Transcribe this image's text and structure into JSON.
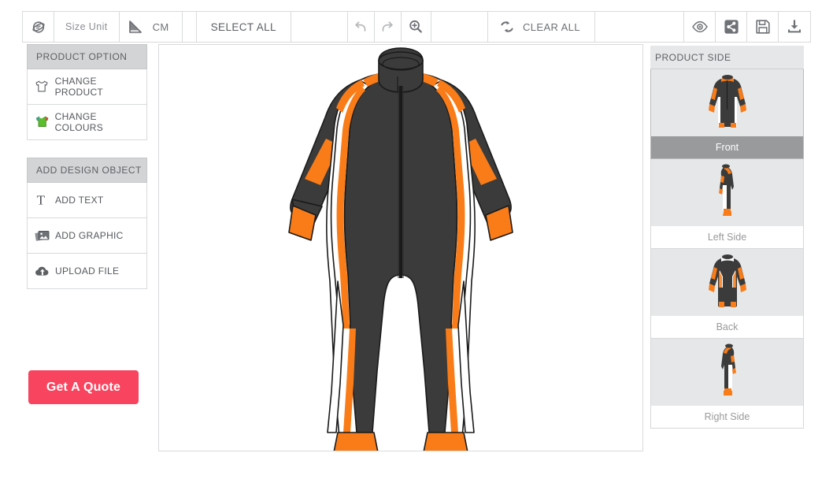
{
  "toolbar": {
    "rotate_icon": "rotate-3d-icon",
    "size_unit_label": "Size Unit",
    "ruler_icon": "ruler-triangle-icon",
    "unit_value": "CM",
    "select_all_label": "SELECT ALL",
    "undo_icon": "undo-icon",
    "redo_icon": "redo-icon",
    "zoom_icon": "zoom-in-icon",
    "clear_icon": "refresh-icon",
    "clear_all_label": "CLEAR ALL",
    "preview_icon": "eye-icon",
    "share_icon": "share-icon",
    "save_icon": "floppy-save-icon",
    "download_icon": "download-icon"
  },
  "sidebar": {
    "product_option": {
      "title": "PRODUCT OPTION",
      "items": [
        {
          "label": "CHANGE PRODUCT",
          "icon": "tshirt-outline-icon"
        },
        {
          "label": "CHANGE COLOURS",
          "icon": "tshirt-colour-icon"
        }
      ]
    },
    "add_design_object": {
      "title": "ADD DESIGN OBJECT",
      "items": [
        {
          "label": "ADD TEXT",
          "icon": "text-t-icon"
        },
        {
          "label": "ADD GRAPHIC",
          "icon": "images-icon"
        },
        {
          "label": "UPLOAD FILE",
          "icon": "cloud-upload-icon"
        }
      ]
    },
    "quote_button": {
      "label": "Get A Quote",
      "color": "#f8445e"
    }
  },
  "product_side": {
    "title": "PRODUCT SIDE",
    "selected": "Front",
    "items": [
      {
        "label": "Front",
        "view": "front",
        "selected": true
      },
      {
        "label": "Left Side",
        "view": "left",
        "selected": false
      },
      {
        "label": "Back",
        "view": "back",
        "selected": false
      },
      {
        "label": "Right Side",
        "view": "right",
        "selected": false
      }
    ]
  },
  "canvas": {
    "product": "racing-suit-front",
    "colors": {
      "body": "#3b3b3b",
      "accent": "#f97c18",
      "panel": "#ffffff",
      "outline": "#1a1a1a"
    }
  }
}
